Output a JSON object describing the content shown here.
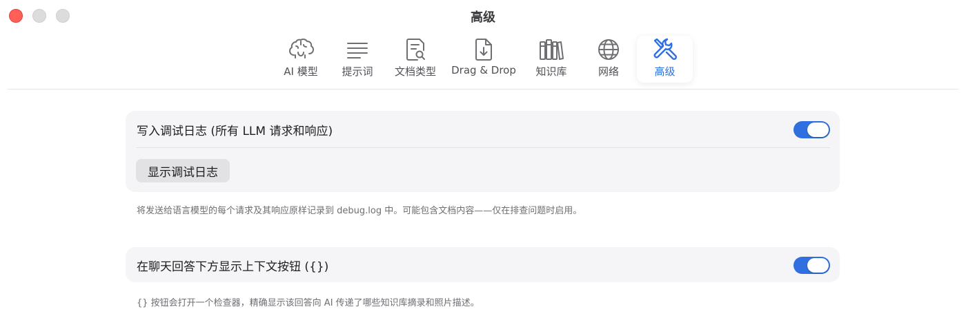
{
  "window": {
    "title": "高级"
  },
  "toolbar": {
    "tabs": [
      {
        "label": "AI 模型",
        "icon": "brain-icon"
      },
      {
        "label": "提示词",
        "icon": "text-lines-icon"
      },
      {
        "label": "文档类型",
        "icon": "document-search-icon"
      },
      {
        "label": "Drag & Drop",
        "icon": "document-download-icon"
      },
      {
        "label": "知识库",
        "icon": "books-icon"
      },
      {
        "label": "网络",
        "icon": "globe-icon"
      },
      {
        "label": "高级",
        "icon": "tools-icon",
        "active": true
      }
    ]
  },
  "debug_log": {
    "label": "写入调试日志 (所有 LLM 请求和响应)",
    "enabled": true,
    "show_button": "显示调试日志",
    "caption": "将发送给语言模型的每个请求及其响应原样记录到 debug.log 中。可能包含文档内容——仅在排查问题时启用。"
  },
  "context_button": {
    "label": "在聊天回答下方显示上下文按钮 ({})",
    "enabled": true,
    "caption": "{} 按钮会打开一个检查器，精确显示该回答向 AI 传递了哪些知识库摘录和照片描述。"
  },
  "colors": {
    "accent": "#2f6fe0",
    "close": "#fe5f57",
    "card_bg": "#f5f5f7"
  }
}
